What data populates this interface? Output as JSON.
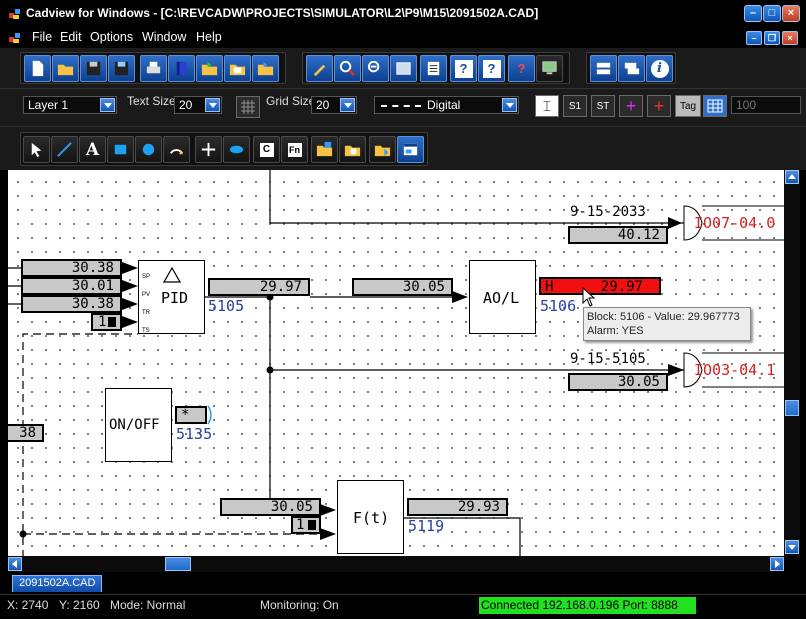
{
  "window": {
    "title": "Cadview for Windows - [C:\\REVCADW\\PROJECTS\\SIMULATOR\\L2\\P9\\M15\\2091502A.CAD]",
    "icons": [
      "minimize-icon",
      "maximize-icon",
      "close-icon"
    ],
    "accent_color": "#1557b5"
  },
  "menu": {
    "items": [
      "File",
      "Edit",
      "Options",
      "Window",
      "Help"
    ]
  },
  "toolbar2": {
    "layer_value": "Layer 1",
    "text_size_label": "Text Size",
    "text_size_value": "20",
    "grid_size_label": "Grid Size",
    "grid_size_value": "20",
    "line_style_value": "Digital",
    "s1_label": "S1",
    "st_label": "ST",
    "tag_label": "Tag",
    "zoom_value": "100"
  },
  "diagram": {
    "date_top": "9-15-2033",
    "val_top": "40.12",
    "offpage_top": "IO07-04.0",
    "pid_in_sp": "30.38",
    "pid_in_pv": "30.01",
    "pid_in_tr": "30.38",
    "pid_in_ts": "1",
    "pid_label": "PID",
    "pid_pin_sp": "SP",
    "pid_pin_pv": "PV",
    "pid_pin_tr": "TR",
    "pid_pin_ts": "TS",
    "pid_out": "29.97",
    "pid_id": "5105",
    "ao_in": "30.05",
    "ao_label": "AO/L",
    "ao_alarm_prefix": "H",
    "ao_alarm_value": "29.97",
    "ao_id": "5106",
    "date_mid": "9-15-5105",
    "val_mid": "30.05",
    "offpage_mid": "IO03-04.1",
    "onoff_label": "ON/OFF",
    "onoff_val": "*",
    "onoff_id": "5135",
    "left_val": "38",
    "ft_in": "30.05",
    "ft_in2": "1",
    "ft_label": "F(t)",
    "ft_out": "29.93",
    "ft_id": "5119"
  },
  "tooltip": {
    "line1": "Block: 5106 - Value: 29.967773",
    "line2": "Alarm: YES"
  },
  "tabs": [
    "2091502A.CAD"
  ],
  "status": {
    "x": "X: 2740",
    "y": "Y: 2160",
    "mode": "Mode: Normal",
    "monitoring": "Monitoring: On",
    "connection": "Connected 192.168.0.196   Port: 8888"
  }
}
